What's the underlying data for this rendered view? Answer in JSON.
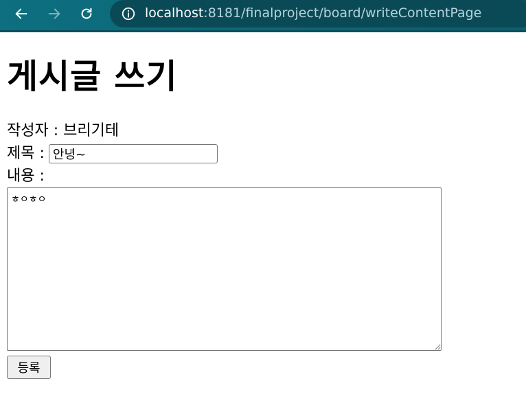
{
  "browser": {
    "url_host": "localhost",
    "url_rest": ":8181/finalproject/board/writeContentPage",
    "icons": [
      "back-arrow-icon",
      "forward-arrow-icon",
      "reload-icon",
      "info-icon"
    ]
  },
  "page": {
    "heading": "게시글 쓰기",
    "author_line": "작성자 : 브리기테",
    "title_label": "제목 :",
    "title_value": "안녕~",
    "content_label": "내용 :",
    "content_value": "ㅎㅇㅎㅇ",
    "submit_label": "등록"
  },
  "colors": {
    "browser_bar": "#0d6f80",
    "url_pill": "#0a4a57"
  }
}
